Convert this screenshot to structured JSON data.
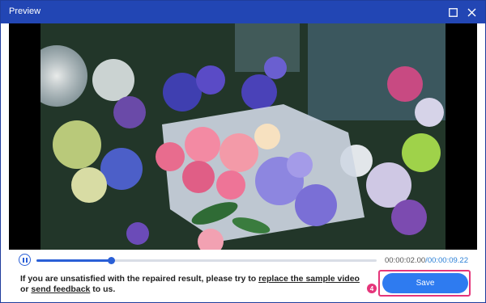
{
  "window": {
    "title": "Preview",
    "maximize_icon": "maximize-icon",
    "close_icon": "close-icon"
  },
  "player": {
    "progress_fraction": 0.218,
    "current_time": "00:00:02.00",
    "separator": "/",
    "total_time": "00:00:09.22",
    "state_icon": "pause-icon"
  },
  "message": {
    "text_before": "If you are unsatisfied with the repaired result, please try to ",
    "link_replace": "replace the sample video",
    "text_middle": " or ",
    "link_feedback": "send feedback",
    "text_after": " to us."
  },
  "actions": {
    "badge": "4",
    "save_label": "Save"
  },
  "colors": {
    "titlebar": "#2246b4",
    "accent": "#2e7bf0",
    "highlight": "#e5357a"
  }
}
